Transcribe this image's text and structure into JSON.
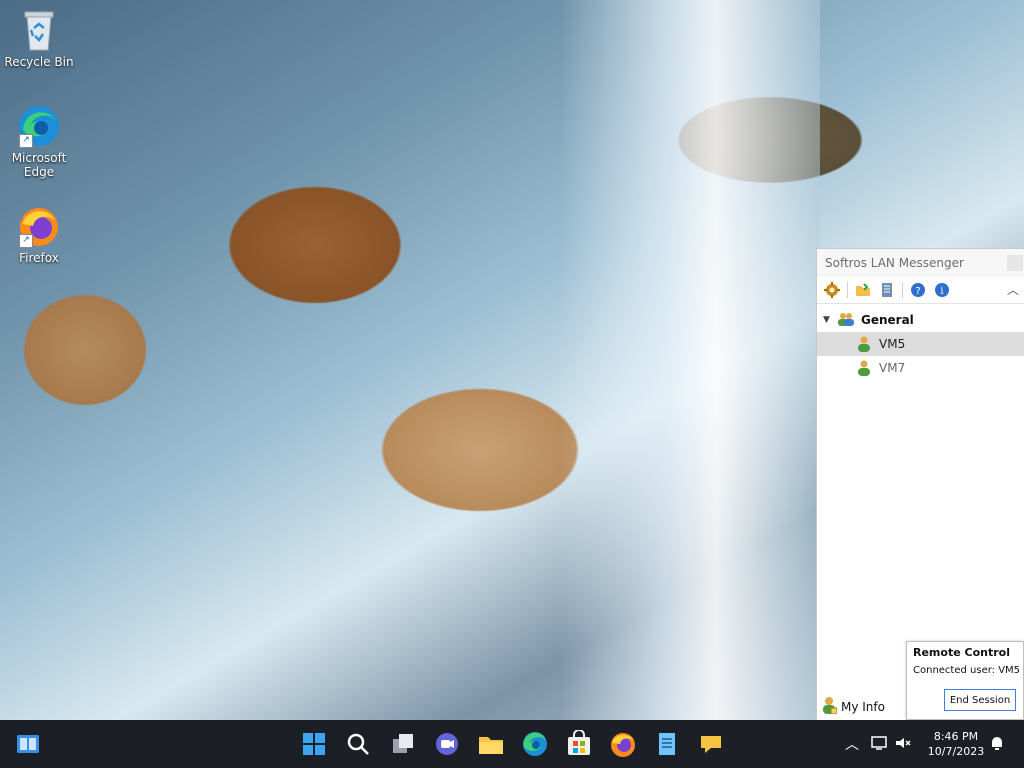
{
  "desktop": {
    "icons": [
      {
        "label": "Recycle Bin",
        "icon": "recycle-bin-icon"
      },
      {
        "label": "Microsoft Edge",
        "icon": "edge-icon"
      },
      {
        "label": "Firefox",
        "icon": "firefox-icon"
      }
    ]
  },
  "messenger": {
    "title": "Softros LAN Messenger",
    "toolbar": [
      "settings-icon",
      "open-folder-icon",
      "message-log-icon",
      "help-icon",
      "about-icon"
    ],
    "group": {
      "name": "General",
      "expanded": true
    },
    "users": [
      {
        "name": "VM5",
        "selected": true
      },
      {
        "name": "VM7",
        "selected": false
      }
    ],
    "my_info_label": "My Info"
  },
  "remote_control": {
    "title": "Remote Control",
    "connected_user": "Connected user: VM5",
    "end_session_label": "End Session"
  },
  "taskbar": {
    "apps": [
      "widgets-icon",
      "start-icon",
      "search-icon",
      "task-view-icon",
      "teams-chat-icon",
      "file-explorer-icon",
      "edge-icon",
      "store-icon",
      "firefox-icon",
      "notepad-icon",
      "softros-messenger-icon"
    ],
    "clock": {
      "time": "8:46 PM",
      "date": "10/7/2023"
    }
  },
  "colors": {
    "taskbar": "#1c2026",
    "accent": "#3f7ed8",
    "selection": "#dcdcdc"
  }
}
